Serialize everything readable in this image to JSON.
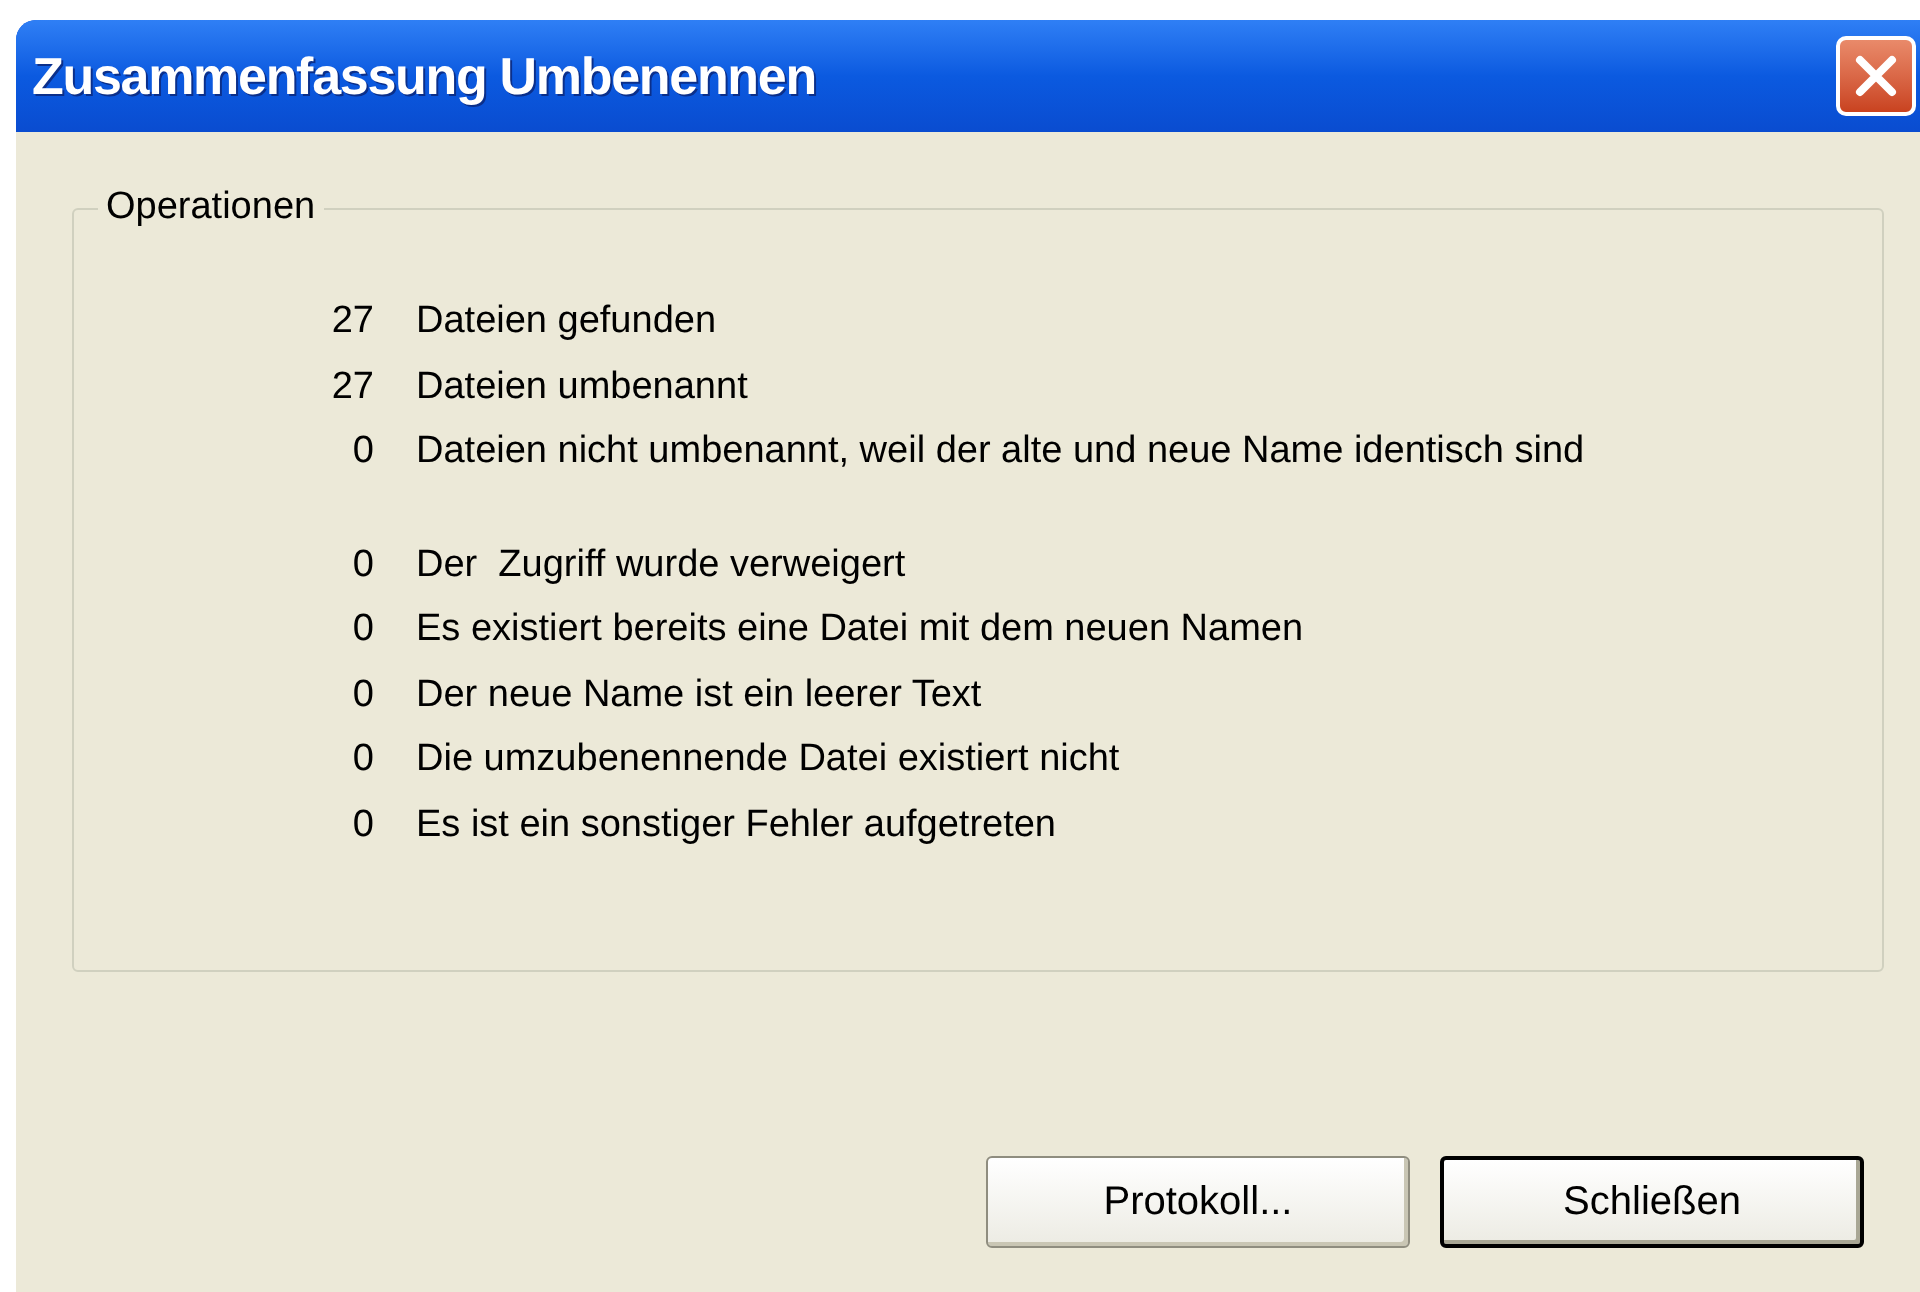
{
  "window": {
    "title": "Zusammenfassung Umbenennen"
  },
  "group": {
    "label": "Operationen",
    "sections": [
      {
        "rows": [
          {
            "count": "27",
            "text": "Dateien gefunden"
          },
          {
            "count": "27",
            "text": "Dateien umbenannt"
          },
          {
            "count": "0",
            "text": "Dateien nicht umbenannt, weil der alte und neue Name identisch sind"
          }
        ]
      },
      {
        "rows": [
          {
            "count": "0",
            "text": "Der  Zugriff wurde verweigert"
          },
          {
            "count": "0",
            "text": "Es existiert bereits eine Datei mit dem neuen Namen"
          },
          {
            "count": "0",
            "text": "Der neue Name ist ein leerer Text"
          },
          {
            "count": "0",
            "text": "Die umzubenennende Datei existiert nicht"
          },
          {
            "count": "0",
            "text": "Es ist ein sonstiger Fehler aufgetreten"
          }
        ]
      }
    ]
  },
  "buttons": [
    {
      "label": "Protokoll...",
      "default": false
    },
    {
      "label": "Schließen",
      "default": true
    }
  ]
}
